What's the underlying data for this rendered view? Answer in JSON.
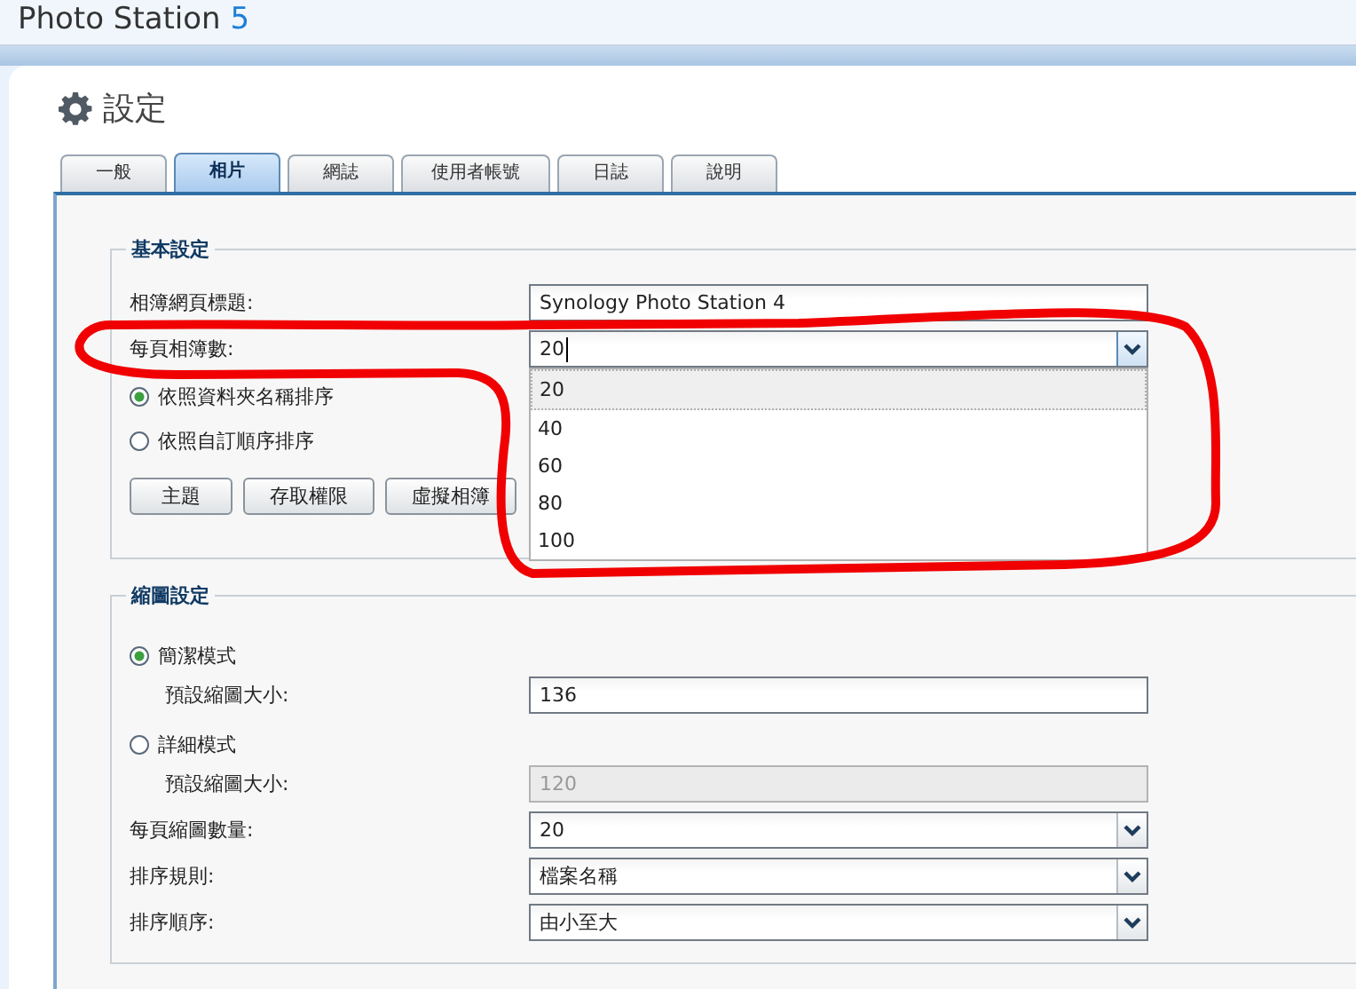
{
  "app_title": {
    "name": "Photo Station ",
    "version": "5"
  },
  "page_title": "設定",
  "tabs": [
    {
      "label": "一般",
      "selected": false
    },
    {
      "label": "相片",
      "selected": true
    },
    {
      "label": "網誌",
      "selected": false
    },
    {
      "label": "使用者帳號",
      "selected": false
    },
    {
      "label": "日誌",
      "selected": false
    },
    {
      "label": "說明",
      "selected": false
    }
  ],
  "basic_settings": {
    "legend": "基本設定",
    "fields": [
      {
        "label": "相簿網頁標題:",
        "kind": "text",
        "value": "Synology Photo Station 4"
      },
      {
        "label": "每頁相簿數:",
        "kind": "select",
        "value": "20",
        "expanded": true,
        "options": [
          {
            "label": "20",
            "selected": true
          },
          {
            "label": "40",
            "selected": false
          },
          {
            "label": "60",
            "selected": false
          },
          {
            "label": "80",
            "selected": false
          },
          {
            "label": "100",
            "selected": false
          }
        ]
      }
    ],
    "sort_options": [
      {
        "label": "依照資料夾名稱排序",
        "selected": true
      },
      {
        "label": "依照自訂順序排序",
        "selected": false
      }
    ],
    "buttons": [
      "主題",
      "存取權限",
      "虛擬相簿"
    ]
  },
  "thumbnail_settings": {
    "legend": "縮圖設定",
    "modes": [
      {
        "label": "簡潔模式",
        "selected": true,
        "field": {
          "label": "預設縮圖大小:",
          "value": "136",
          "disabled": false
        }
      },
      {
        "label": "詳細模式",
        "selected": false,
        "field": {
          "label": "預設縮圖大小:",
          "value": "120",
          "disabled": true
        }
      }
    ],
    "fields": [
      {
        "label": "每頁縮圖數量:",
        "kind": "select",
        "value": "20",
        "expanded": false
      },
      {
        "label": "排序規則:",
        "kind": "select",
        "value": "檔案名稱",
        "expanded": false
      },
      {
        "label": "排序順序:",
        "kind": "select",
        "value": "由小至大",
        "expanded": false
      }
    ]
  },
  "highlight_mark": {
    "kind": "loop"
  }
}
